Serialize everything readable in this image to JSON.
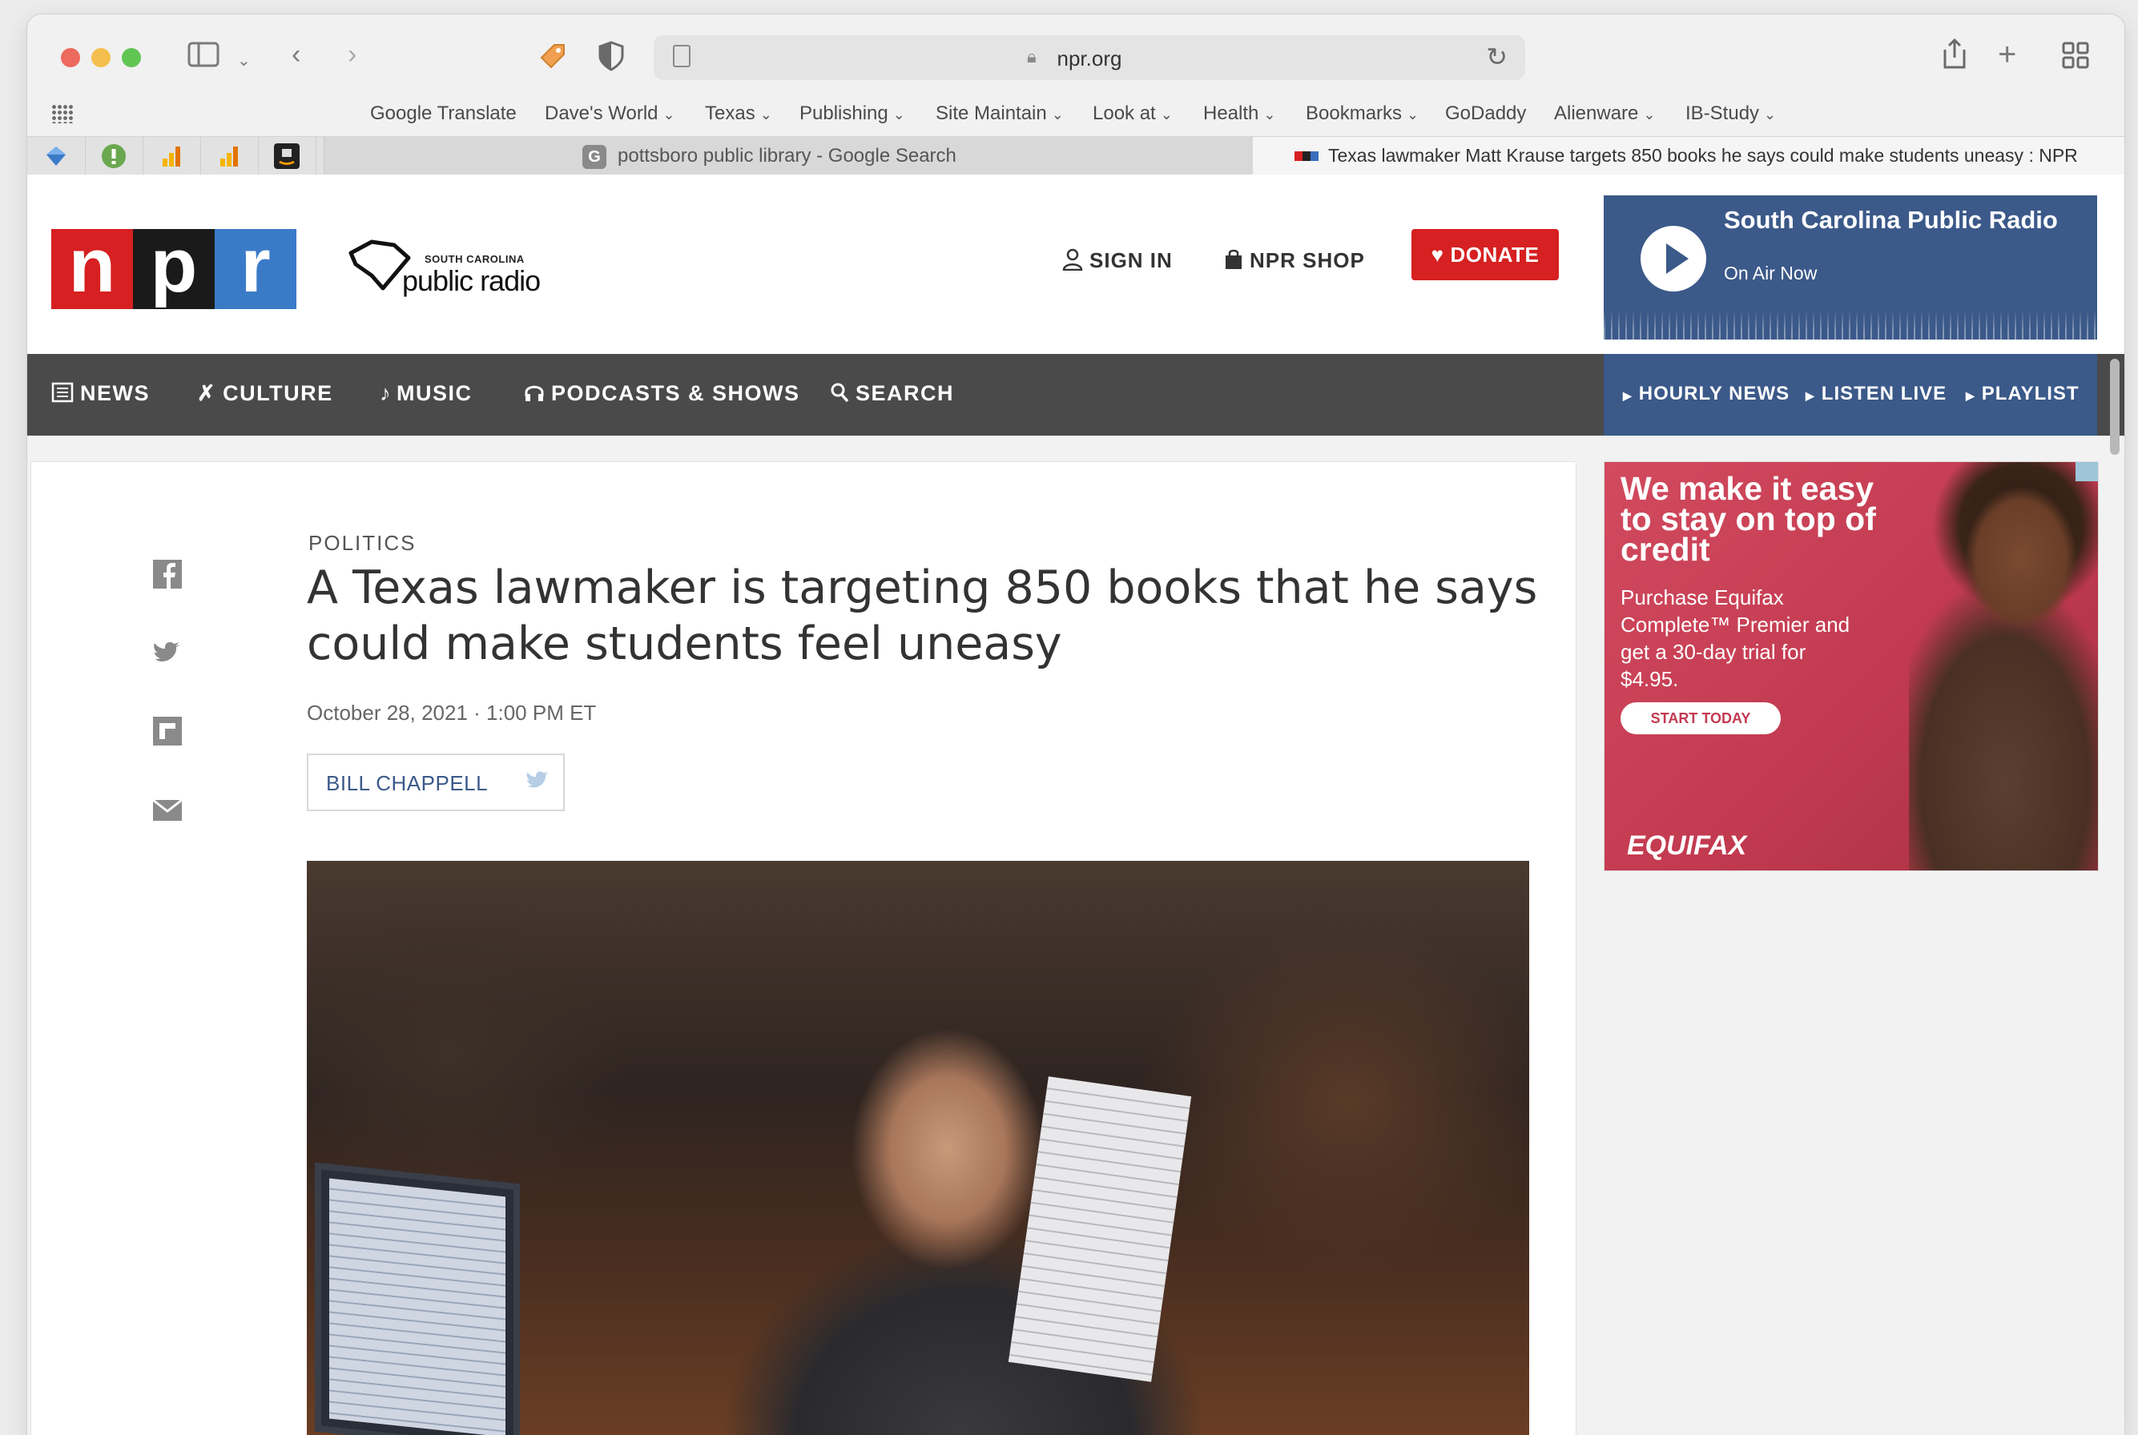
{
  "browser": {
    "address": "npr.org",
    "bookmarks": [
      {
        "label": "Google Translate",
        "menu": false
      },
      {
        "label": "Dave's World",
        "menu": true
      },
      {
        "label": "Texas",
        "menu": true
      },
      {
        "label": "Publishing",
        "menu": true
      },
      {
        "label": "Site Maintain",
        "menu": true
      },
      {
        "label": "Look at",
        "menu": true
      },
      {
        "label": "Health",
        "menu": true
      },
      {
        "label": "Bookmarks",
        "menu": true
      },
      {
        "label": "GoDaddy",
        "menu": false
      },
      {
        "label": "Alienware",
        "menu": true
      },
      {
        "label": "IB-Study",
        "menu": true
      }
    ],
    "tabs": [
      {
        "title": "pottsboro public library - Google Search",
        "favicon": "G"
      },
      {
        "title": "Texas lawmaker Matt Krause targets 850 books he says could make students uneasy : NPR"
      }
    ]
  },
  "header": {
    "logo": [
      "n",
      "p",
      "r"
    ],
    "station_logo": {
      "small": "SOUTH CAROLINA",
      "big": "public radio"
    },
    "sign_in": "SIGN IN",
    "shop": "NPR SHOP",
    "donate": "DONATE",
    "player": {
      "station": "South Carolina Public Radio",
      "status": "On Air Now"
    }
  },
  "nav": {
    "items": [
      "NEWS",
      "CULTURE",
      "MUSIC",
      "PODCASTS & SHOWS",
      "SEARCH"
    ],
    "right": [
      "HOURLY NEWS",
      "LISTEN LIVE",
      "PLAYLIST"
    ]
  },
  "article": {
    "category": "POLITICS",
    "headline": "A Texas lawmaker is targeting 850 books that he says could make students feel uneasy",
    "date": "October 28, 2021 · 1:00 PM ET",
    "author": "BILL CHAPPELL"
  },
  "ad": {
    "headline": "We make it easy to stay on top of credit",
    "body": "Purchase Equifax Complete™ Premier and get a 30-day trial for $4.95.",
    "cta": "START TODAY",
    "brand": "EQUIFAX"
  },
  "colors": {
    "npr_red": "#d62021",
    "npr_blue": "#3a7bc8",
    "player_blue": "#3b5989",
    "nav_gray": "#4a4a4a"
  }
}
